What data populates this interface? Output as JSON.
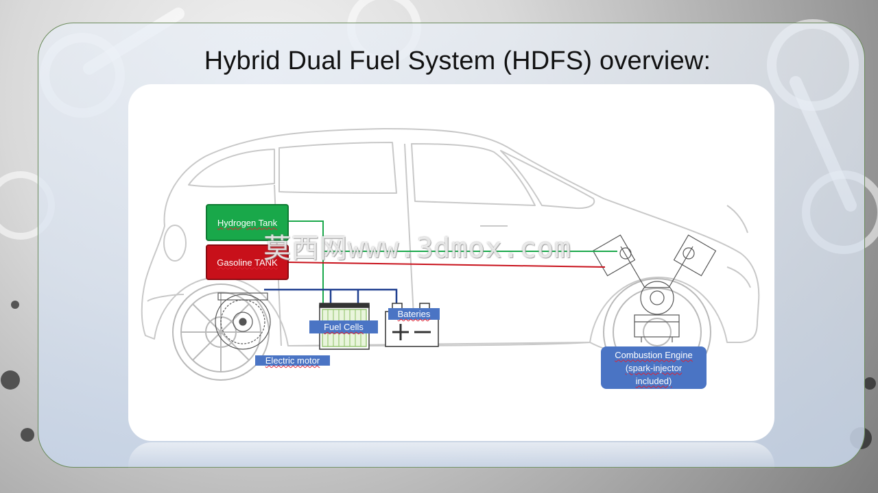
{
  "slide": {
    "title": "Hybrid Dual Fuel System (HDFS) overview:"
  },
  "labels": {
    "hydrogen_tank": "Hydrogen Tank",
    "gasoline_tank": "Gasoline TANK",
    "fuel_cells": "Fuel Cells",
    "batteries": "Bateries",
    "electric_motor": "Electric motor",
    "combustion_engine_line1": "Combustion Engine",
    "combustion_engine_line2": "(spark-injector",
    "combustion_engine_line3": "included)"
  },
  "watermark": "莫西网www.3dmox.com",
  "colors": {
    "hydrogen": "#19a84a",
    "gasoline": "#c8101a",
    "electric": "#1f3f8f",
    "label_blue": "#4a74c4"
  }
}
